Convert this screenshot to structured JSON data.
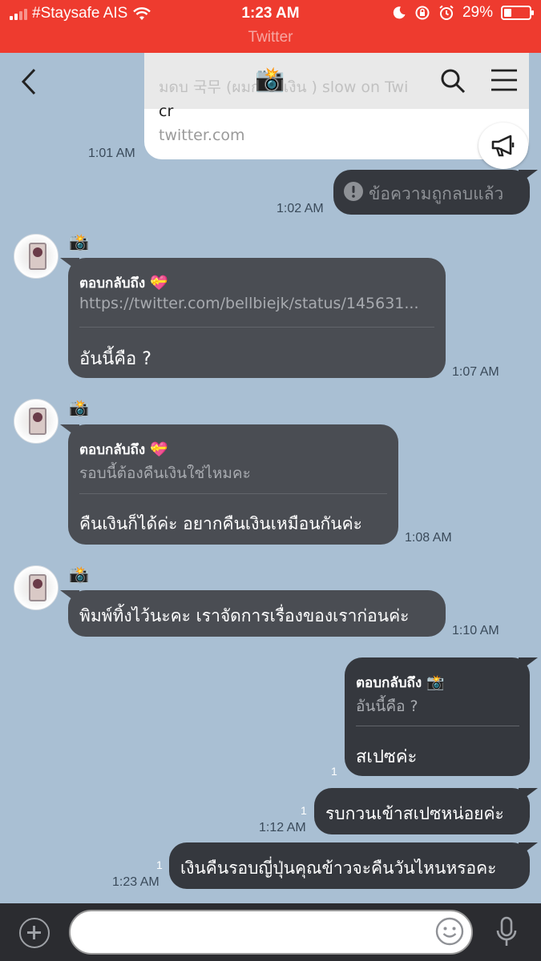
{
  "status_bar": {
    "carrier": "#Staysafe AIS",
    "time": "1:23 AM",
    "battery": "29%",
    "battery_level": 0.29,
    "back_to_app": "Twitter"
  },
  "header": {
    "chat_title": "📸"
  },
  "link_preview": {
    "faded_title": "มดบ 국무 (ผมกเสียเงิน ) slow on Twi",
    "snippet": "cr",
    "domain": "twitter.com"
  },
  "messages": [
    {
      "time": "1:01 AM"
    },
    {
      "text": "ข้อความถูกลบแล้ว",
      "time": "1:02 AM"
    },
    {
      "sender_emoji": "📸",
      "reply_label": "ตอบกลับถึง",
      "reply_emoji": "💝",
      "reply_quote": "https://twitter.com/bellbiejk/status/145631...",
      "text": "อันนี้คือ ?",
      "time": "1:07 AM"
    },
    {
      "sender_emoji": "📸",
      "reply_label": "ตอบกลับถึง",
      "reply_emoji": "💝",
      "reply_quote": "รอบนี้ต้องคืนเงินใช่ไหมคะ",
      "text": "คืนเงินก็ได้ค่ะ อยากคืนเงินเหมือนกันค่ะ",
      "time": "1:08 AM"
    },
    {
      "sender_emoji": "📸",
      "text": "พิมพ์ทิ้งไว้นะคะ เราจัดการเรื่องของเราก่อนค่ะ",
      "time": "1:10 AM"
    },
    {
      "reply_label": "ตอบกลับถึง",
      "reply_emoji": "📸",
      "reply_quote": "อันนี้คือ ?",
      "text": "สเปซค่ะ",
      "read": "1"
    },
    {
      "text": "รบกวนเข้าสเปซหน่อยค่ะ",
      "read": "1",
      "time": "1:12 AM"
    },
    {
      "text": "เงินคืนรอบญี่ปุ่นคุณข้าวจะคืนวันไหนหรอคะ",
      "read": "1",
      "time": "1:23 AM"
    }
  ],
  "input": {
    "placeholder": ""
  }
}
